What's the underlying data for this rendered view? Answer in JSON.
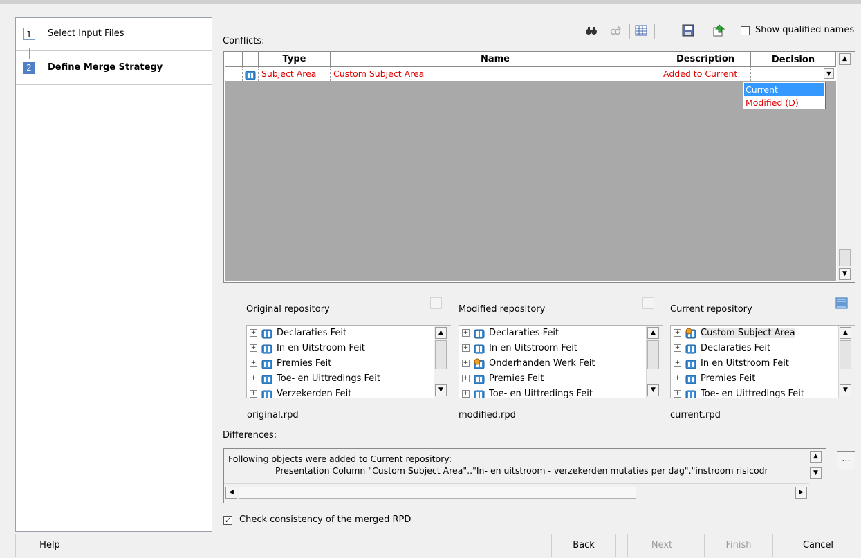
{
  "steps": [
    {
      "number": "1",
      "label": "Select Input Files"
    },
    {
      "number": "2",
      "label": "Define Merge Strategy"
    }
  ],
  "conflicts": {
    "label": "Conflicts:",
    "show_qualified_names": "Show qualified names",
    "show_qualified_checked": false,
    "toolbar_icons": [
      "binoculars-icon",
      "find-next-icon",
      "table-icon",
      "save-icon",
      "export-icon"
    ],
    "columns": {
      "type": "Type",
      "name": "Name",
      "description": "Description",
      "decision": "Decision"
    },
    "rows": [
      {
        "type": "Subject Area",
        "name": "Custom Subject Area",
        "description": "Added to Current",
        "decision": ""
      }
    ],
    "decision_options": [
      "Current",
      "Modified  (D)"
    ]
  },
  "repositories": {
    "original": {
      "label": "Original repository",
      "file": "original.rpd",
      "items": [
        "Declaraties Feit",
        "In en Uitstroom Feit",
        "Premies Feit",
        "Toe- en Uittredings Feit",
        "Verzekerden Feit"
      ]
    },
    "modified": {
      "label": "Modified repository",
      "file": "modified.rpd",
      "items": [
        "Declaraties Feit",
        "In en Uitstroom Feit",
        "Onderhanden Werk Feit",
        "Premies Feit",
        "Toe- en Uittredings Feit"
      ]
    },
    "current": {
      "label": "Current repository",
      "file": "current.rpd",
      "items": [
        "Custom Subject Area",
        "Declaraties Feit",
        "In en Uitstroom Feit",
        "Premies Feit",
        "Toe- en Uittredings Feit"
      ]
    }
  },
  "differences": {
    "label": "Differences:",
    "line1": "Following objects were added to Current repository:",
    "line2": "Presentation Column \"Custom Subject Area\"..\"In- en uitstroom - verzekerden mutaties per dag\".\"instroom risicodr",
    "more_button": "..."
  },
  "consistency": {
    "label": "Check consistency of the merged RPD",
    "checked": true
  },
  "buttons": {
    "help": "Help",
    "back": "Back",
    "next": "Next",
    "finish": "Finish",
    "cancel": "Cancel"
  }
}
